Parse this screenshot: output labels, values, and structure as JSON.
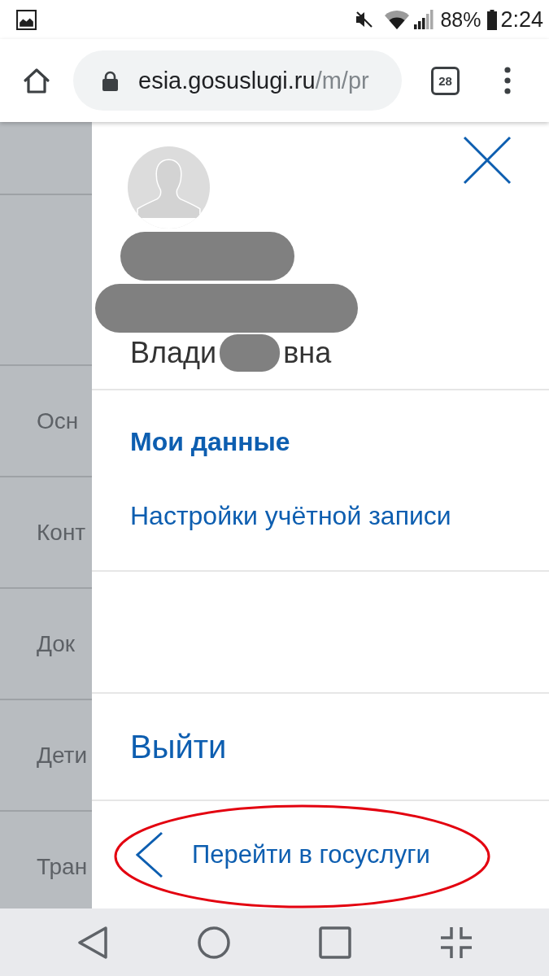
{
  "status_bar": {
    "battery": "88%",
    "time": "2:24"
  },
  "browser_toolbar": {
    "url_host": "esia.gosuslugi.ru",
    "url_path": "/m/pr",
    "tab_count": "28"
  },
  "background_menu": {
    "items": [
      "Осн",
      "Конт",
      "Док",
      "Дети",
      "Тран"
    ]
  },
  "drawer": {
    "name_visible_parts": [
      "Влади",
      "вна"
    ],
    "menu": [
      {
        "label": "Мои данные",
        "selected": true
      },
      {
        "label": "Настройки учётной записи",
        "selected": false
      }
    ],
    "logout": "Выйти",
    "back_link": {
      "label": "Перейти в госуслуги",
      "circled": true
    }
  }
}
